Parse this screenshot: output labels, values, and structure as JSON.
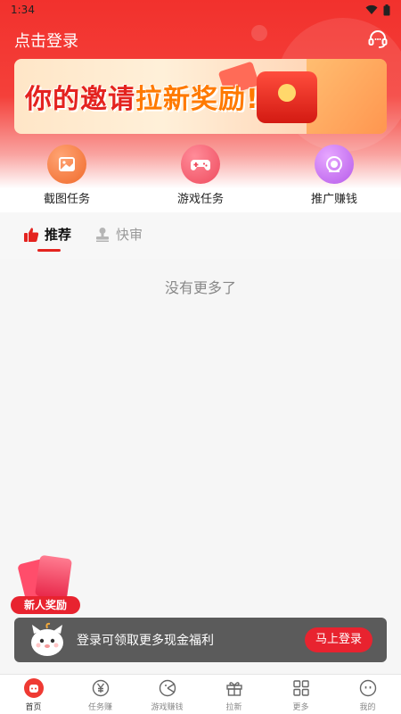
{
  "status_bar": {
    "time": "1:34",
    "icons": [
      "wifi-icon",
      "battery-icon"
    ]
  },
  "header": {
    "login_label": "点击登录",
    "service_icon": "headset-icon"
  },
  "banner": {
    "text_main": "你的邀请",
    "text_highlight": "拉新奖励!"
  },
  "quick_menu": [
    {
      "label": "截图任务",
      "icon": "image-icon",
      "color": "#f06a2b"
    },
    {
      "label": "游戏任务",
      "icon": "gamepad-icon",
      "color": "#ef4b5e"
    },
    {
      "label": "推广赚钱",
      "icon": "promo-icon",
      "color": "#b65bea"
    }
  ],
  "tabs": [
    {
      "label": "推荐",
      "icon": "thumbs-up-icon",
      "active": true
    },
    {
      "label": "快审",
      "icon": "stamp-icon",
      "active": false
    }
  ],
  "feed": {
    "empty_text": "没有更多了"
  },
  "reward_float": {
    "label": "新人奖励"
  },
  "login_prompt": {
    "text": "登录可领取更多现金福利",
    "button_label": "马上登录"
  },
  "bottom_nav": [
    {
      "label": "首页",
      "icon": "home-icon",
      "active": true
    },
    {
      "label": "任务赚",
      "icon": "yen-icon",
      "active": false
    },
    {
      "label": "游戏赚钱",
      "icon": "game-icon",
      "active": false
    },
    {
      "label": "拉新",
      "icon": "gift-icon",
      "active": false
    },
    {
      "label": "更多",
      "icon": "grid-icon",
      "active": false
    },
    {
      "label": "我的",
      "icon": "face-icon",
      "active": false
    }
  ],
  "colors": {
    "brand_red": "#e4231f",
    "header_red": "#f2312d"
  }
}
